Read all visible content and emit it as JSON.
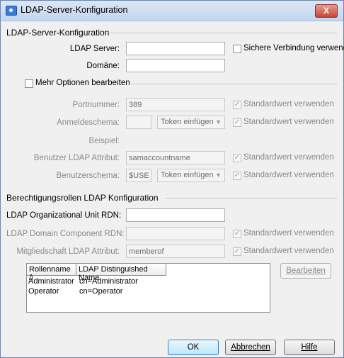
{
  "window": {
    "title": "LDAP-Server-Konfiguration",
    "close_label": "X"
  },
  "server_section": {
    "title": "LDAP-Server-Konfiguration",
    "server_label": "LDAP Server:",
    "server_value": "",
    "secure_label": "Sichere Verbindung verwenden",
    "domain_label": "Domäne:",
    "domain_value": ""
  },
  "options_section": {
    "toggle_label": "Mehr Optionen bearbeiten",
    "port_label": "Portnummer:",
    "port_value": "389",
    "schema_label": "Anmeldeschema:",
    "schema_value": "",
    "example_label": "Beispiel:",
    "user_attr_label": "Benutzer LDAP Attribut:",
    "user_attr_value": "samaccountname",
    "user_schema_label": "Benutzerschema:",
    "user_schema_value": "$USER",
    "token_label": "Token einfügen",
    "default_label": "Standardwert verwenden",
    "check_glyph": "✓"
  },
  "roles_section": {
    "title": "Berechtigungsrollen LDAP Konfiguration",
    "ou_label": "LDAP Organizational Unit RDN:",
    "ou_value": "",
    "dc_label": "LDAP Domain Component RDN:",
    "dc_value": "",
    "membership_label": "Mitgliedschaft LDAP Attribut:",
    "membership_value": "memberof",
    "table": {
      "headers": [
        "Rollenname /\\",
        "LDAP Distinguished Name"
      ],
      "rows": [
        [
          "Administrator",
          "cn=Administrator"
        ],
        [
          "Operator",
          "cn=Operator"
        ]
      ]
    },
    "edit_button": "Bearbeiten"
  },
  "footer": {
    "ok": "OK",
    "cancel": "Abbrechen",
    "help": "Hilfe"
  }
}
